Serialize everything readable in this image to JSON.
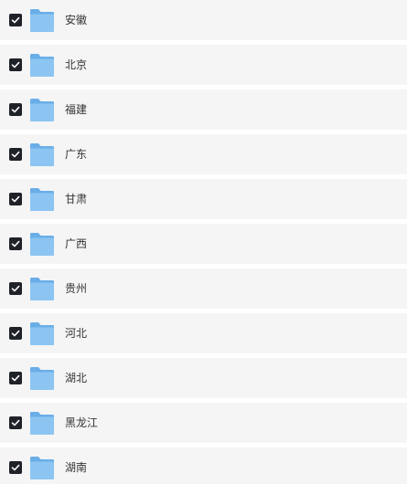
{
  "folders": [
    {
      "name": "安徽",
      "checked": true,
      "icon": "folder-icon"
    },
    {
      "name": "北京",
      "checked": true,
      "icon": "folder-icon"
    },
    {
      "name": "福建",
      "checked": true,
      "icon": "folder-icon"
    },
    {
      "name": "广东",
      "checked": true,
      "icon": "folder-icon"
    },
    {
      "name": "甘肃",
      "checked": true,
      "icon": "folder-icon"
    },
    {
      "name": "广西",
      "checked": true,
      "icon": "folder-icon"
    },
    {
      "name": "贵州",
      "checked": true,
      "icon": "folder-icon"
    },
    {
      "name": "河北",
      "checked": true,
      "icon": "folder-icon"
    },
    {
      "name": "湖北",
      "checked": true,
      "icon": "folder-icon"
    },
    {
      "name": "黑龙江",
      "checked": true,
      "icon": "folder-icon"
    },
    {
      "name": "湖南",
      "checked": true,
      "icon": "folder-icon"
    }
  ],
  "colors": {
    "row_background": "#f5f5f5",
    "checkbox": "#1f2228",
    "folder": "#7cb9ee",
    "text": "#333333"
  }
}
